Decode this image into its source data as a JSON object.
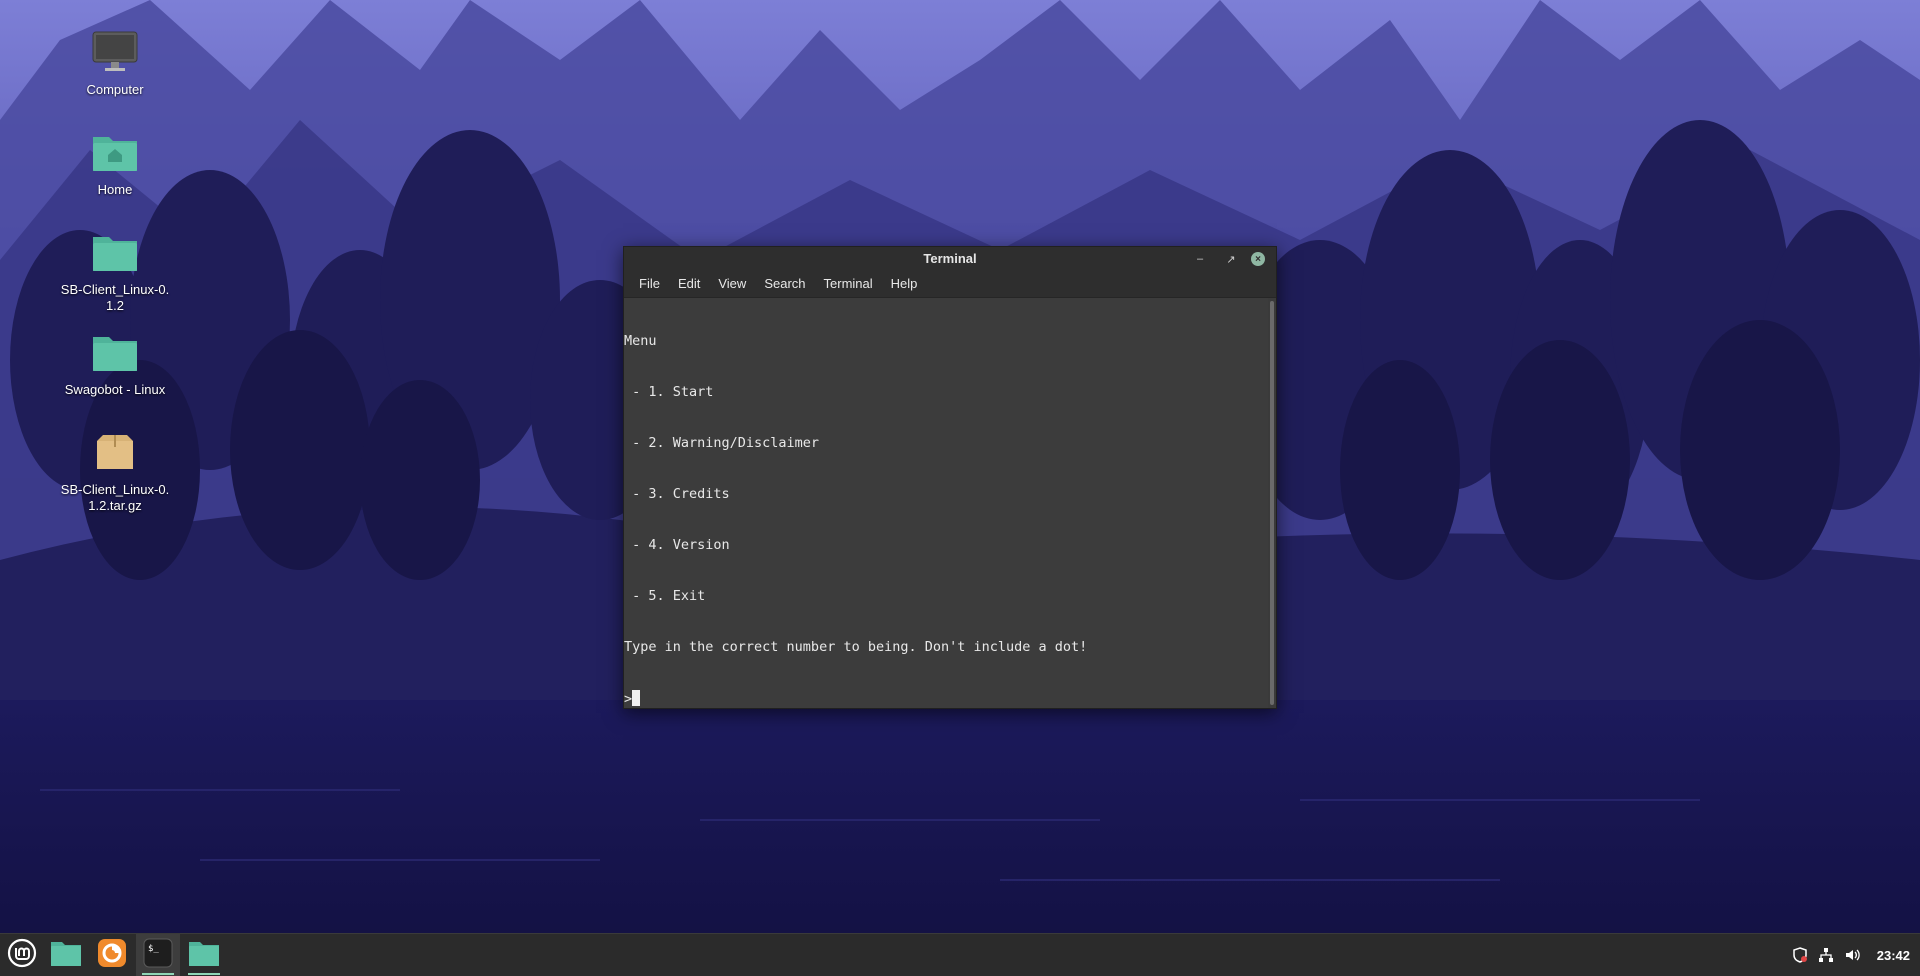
{
  "desktop": {
    "icons": [
      {
        "label": "Computer",
        "icon": "computer-icon"
      },
      {
        "label": "Home",
        "icon": "home-folder-icon"
      },
      {
        "label": "SB-Client_Linux-0.1.2",
        "icon": "folder-icon"
      },
      {
        "label": "Swagobot - Linux",
        "icon": "folder-icon"
      },
      {
        "label": "SB-Client_Linux-0.1.2.tar.gz",
        "icon": "archive-icon"
      }
    ]
  },
  "terminal": {
    "title": "Terminal",
    "menu": [
      "File",
      "Edit",
      "View",
      "Search",
      "Terminal",
      "Help"
    ],
    "lines": [
      "Menu",
      " - 1. Start",
      " - 2. Warning/Disclaimer",
      " - 3. Credits",
      " - 4. Version",
      " - 5. Exit",
      "Type in the correct number to being. Don't include a dot!"
    ],
    "prompt": ">"
  },
  "taskbar": {
    "buttons": [
      {
        "icon": "mint-menu-icon"
      },
      {
        "icon": "files-icon"
      },
      {
        "icon": "firefox-icon"
      },
      {
        "icon": "terminal-icon"
      },
      {
        "icon": "folder-window-icon"
      }
    ],
    "tray": [
      "shield-icon",
      "network-icon",
      "volume-icon"
    ],
    "clock": "23:42"
  },
  "colors": {
    "accent": "#8fd6b6",
    "folder": "#5ec4a8",
    "taskbar": "#2b2b2b",
    "terminal_bg": "#3c3c3c"
  }
}
